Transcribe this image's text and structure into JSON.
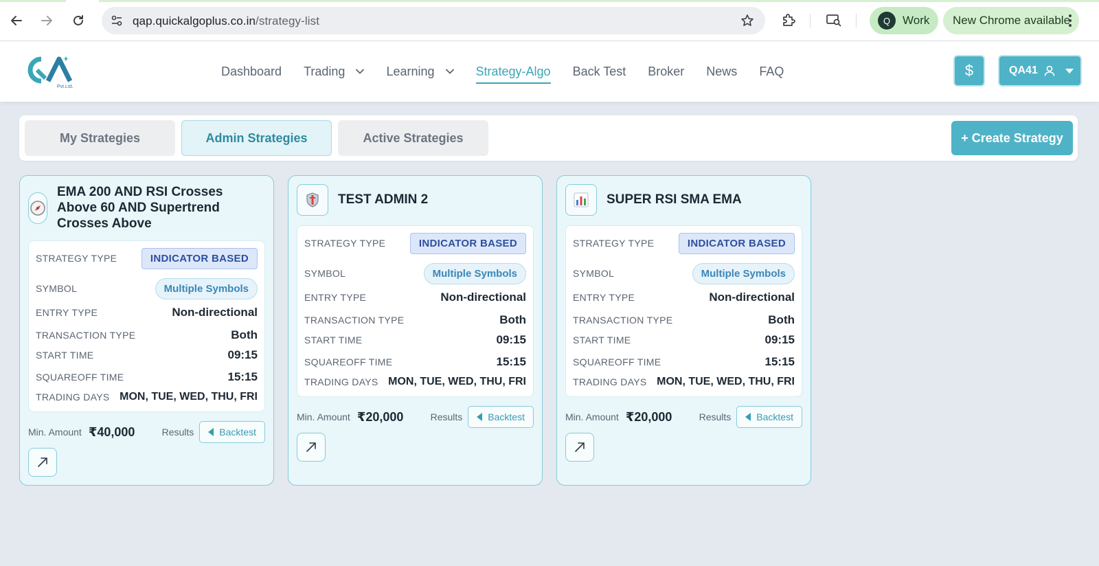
{
  "browser": {
    "url_host": "qap.quickalgoplus.co.in",
    "url_path": "/strategy-list",
    "profile_initial": "Q",
    "profile_label": "Work",
    "update_label": "New Chrome available"
  },
  "header": {
    "nav": [
      {
        "label": "Dashboard"
      },
      {
        "label": "Trading"
      },
      {
        "label": "Learning"
      },
      {
        "label": "Strategy-Algo"
      },
      {
        "label": "Back Test"
      },
      {
        "label": "Broker"
      },
      {
        "label": "News"
      },
      {
        "label": "FAQ"
      }
    ],
    "active_nav": "Strategy-Algo",
    "dollar_symbol": "$",
    "user_label": "QA41",
    "logo_text": "Pvt.Ltd."
  },
  "tabs": {
    "items": [
      {
        "label": "My Strategies"
      },
      {
        "label": "Admin Strategies"
      },
      {
        "label": "Active Strategies"
      }
    ],
    "active": "Admin Strategies",
    "create_label": "+ Create Strategy"
  },
  "labels": {
    "strategy_type": "STRATEGY TYPE",
    "symbol": "SYMBOL",
    "entry_type": "ENTRY TYPE",
    "transaction_type": "TRANSACTION TYPE",
    "start_time": "START TIME",
    "squareoff_time": "SQUAREOFF TIME",
    "trading_days": "TRADING DAYS",
    "min_amount": "Min. Amount",
    "results": "Results",
    "backtest": "Backtest"
  },
  "cards": [
    {
      "icon": "compass-icon",
      "title": "EMA 200 AND RSI Crosses Above 60 AND Supertrend Crosses Above",
      "strategy_type": "INDICATOR BASED",
      "symbol": "Multiple Symbols",
      "entry_type": "Non-directional",
      "transaction_type": "Both",
      "start_time": "09:15",
      "squareoff_time": "15:15",
      "trading_days": "MON, TUE, WED, THU, FRI",
      "min_amount": "₹40,000"
    },
    {
      "icon": "shield-icon",
      "title": "TEST ADMIN 2",
      "strategy_type": "INDICATOR BASED",
      "symbol": "Multiple Symbols",
      "entry_type": "Non-directional",
      "transaction_type": "Both",
      "start_time": "09:15",
      "squareoff_time": "15:15",
      "trading_days": "MON, TUE, WED, THU, FRI",
      "min_amount": "₹20,000"
    },
    {
      "icon": "bar-chart-icon",
      "title": "SUPER RSI SMA EMA",
      "strategy_type": "INDICATOR BASED",
      "symbol": "Multiple Symbols",
      "entry_type": "Non-directional",
      "transaction_type": "Both",
      "start_time": "09:15",
      "squareoff_time": "15:15",
      "trading_days": "MON, TUE, WED, THU, FRI",
      "min_amount": "₹20,000"
    }
  ],
  "colors": {
    "accent": "#4fb3c7",
    "card_bg": "#e9f7fa",
    "card_border": "#86ccda",
    "badge_indicator": "#2e4f9c",
    "badge_symbol": "#3c86b7"
  }
}
